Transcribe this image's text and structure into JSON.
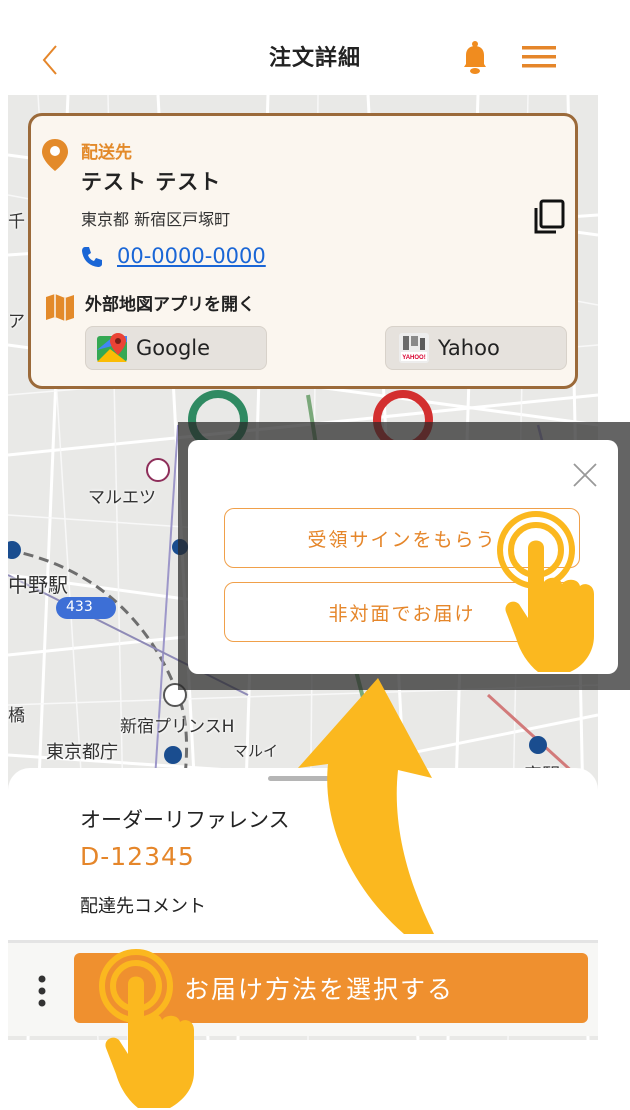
{
  "header": {
    "title": "注文詳細",
    "back_icon": "chevron-left-icon",
    "bell_icon": "bell-icon",
    "menu_icon": "hamburger-menu-icon"
  },
  "map": {
    "labels": {
      "maruetsu": "マルエツ",
      "nakano_station": "中野駅",
      "route_433": "433",
      "shinjuku_prince": "新宿プリンスH",
      "tocho": "東京都庁",
      "marui": "マルイ",
      "shinjuku_prince_small": "新宿プリンスH",
      "left_edge_1": "千",
      "left_edge_2": "ア",
      "left_edge_3": "橋",
      "right_edge": "宿駅"
    }
  },
  "destination": {
    "label": "配送先",
    "name": "テスト テスト",
    "address": "東京都 新宿区戸塚町",
    "phone": "00-0000-0000",
    "open_map_label": "外部地図アプリを開く",
    "google_label": "Google",
    "yahoo_label": "Yahoo",
    "yahoo_badge": "YAHOO!"
  },
  "popup": {
    "sign_button": "受領サインをもらう",
    "contactless_button": "非対面でお届け"
  },
  "sheet": {
    "reference_label": "オーダーリファレンス",
    "reference_value": "D-12345",
    "comment_label": "配達先コメント"
  },
  "footer": {
    "select_button": "お届け方法を選択する"
  },
  "colors": {
    "accent": "#ef902f",
    "accent_text": "#e5862a",
    "link": "#1a66d6",
    "card_border": "#9b6a3a",
    "annotation": "#fbb81f"
  }
}
